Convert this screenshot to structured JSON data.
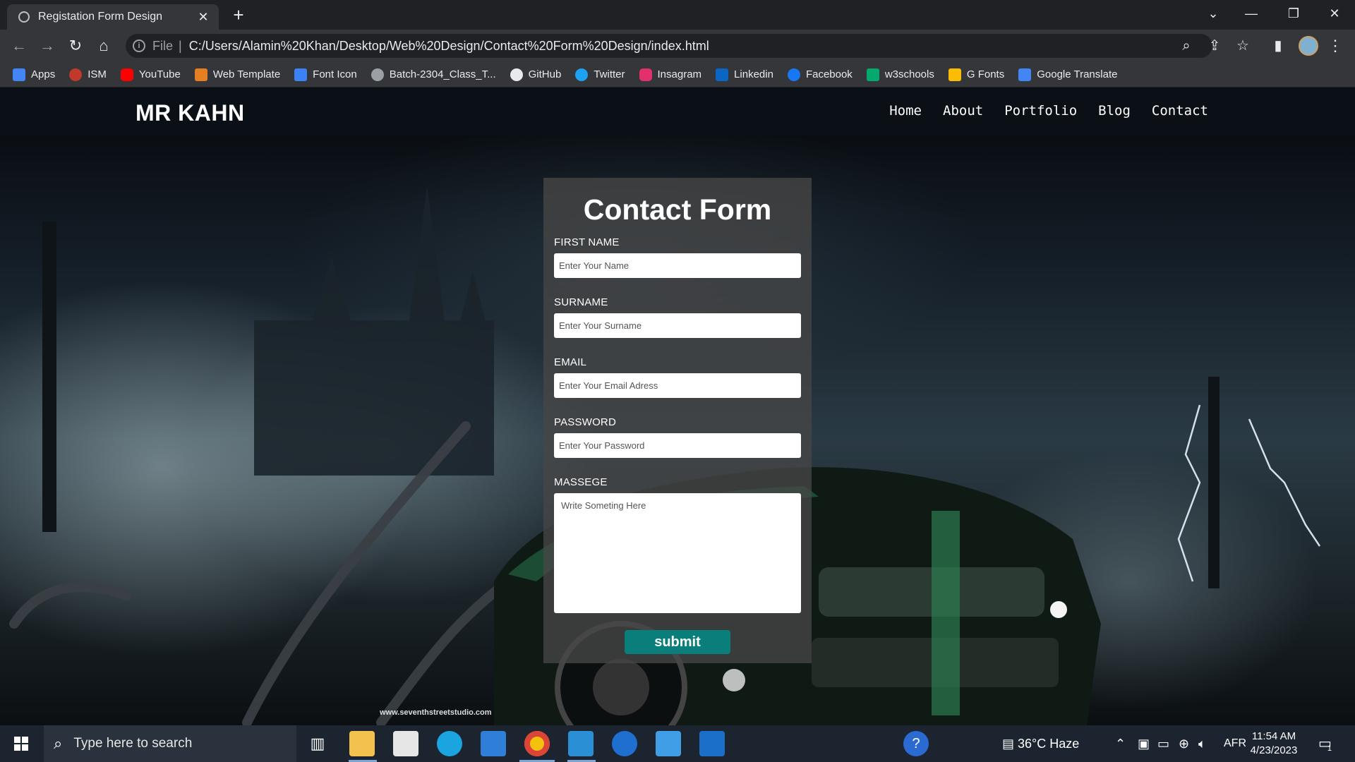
{
  "browser": {
    "tab_title": "Registation Form Design",
    "tab_close": "✕",
    "new_tab": "+",
    "url_scheme": "File",
    "url": "C:/Users/Alamin%20Khan/Desktop/Web%20Design/Contact%20Form%20Design/index.html",
    "bookmarks": [
      {
        "label": "Apps",
        "color": "#4285f4"
      },
      {
        "label": "ISM",
        "color": "#c0392b"
      },
      {
        "label": "YouTube",
        "color": "#ff0000"
      },
      {
        "label": "Web Template",
        "color": "#e67e22"
      },
      {
        "label": "Font Icon",
        "color": "#3b82f6"
      },
      {
        "label": "Batch-2304_Class_T...",
        "color": "#9aa0a6"
      },
      {
        "label": "GitHub",
        "color": "#e8eaed"
      },
      {
        "label": "Twitter",
        "color": "#1da1f2"
      },
      {
        "label": "Insagram",
        "color": "#e1306c"
      },
      {
        "label": "Linkedin",
        "color": "#0a66c2"
      },
      {
        "label": "Facebook",
        "color": "#1877f2"
      },
      {
        "label": "w3schools",
        "color": "#04aa6d"
      },
      {
        "label": "G Fonts",
        "color": "#fbbc05"
      },
      {
        "label": "Google Translate",
        "color": "#4285f4"
      }
    ]
  },
  "site": {
    "logo": "MR KAHN",
    "nav": [
      "Home",
      "About",
      "Portfolio",
      "Blog",
      "Contact"
    ]
  },
  "form": {
    "title": "Contact Form",
    "fields": [
      {
        "label": "FIRST NAME",
        "placeholder": "Enter Your Name"
      },
      {
        "label": "SURNAME",
        "placeholder": "Enter Your Surname"
      },
      {
        "label": "EMAIL",
        "placeholder": "Enter Your Email Adress"
      },
      {
        "label": "PASSWORD",
        "placeholder": "Enter Your Password"
      }
    ],
    "message_label": "MASSEGE",
    "message_placeholder": "Write Someting Here",
    "submit_label": "submit",
    "accent_color": "#0a7e7a"
  },
  "background": {
    "watermark": "www.seventhstreetstudio.com"
  },
  "taskbar": {
    "search_placeholder": "Type here to search",
    "weather": "36°C  Haze",
    "language": "AFR",
    "time": "11:54 AM",
    "date": "4/23/2023",
    "notification_count": "1"
  }
}
